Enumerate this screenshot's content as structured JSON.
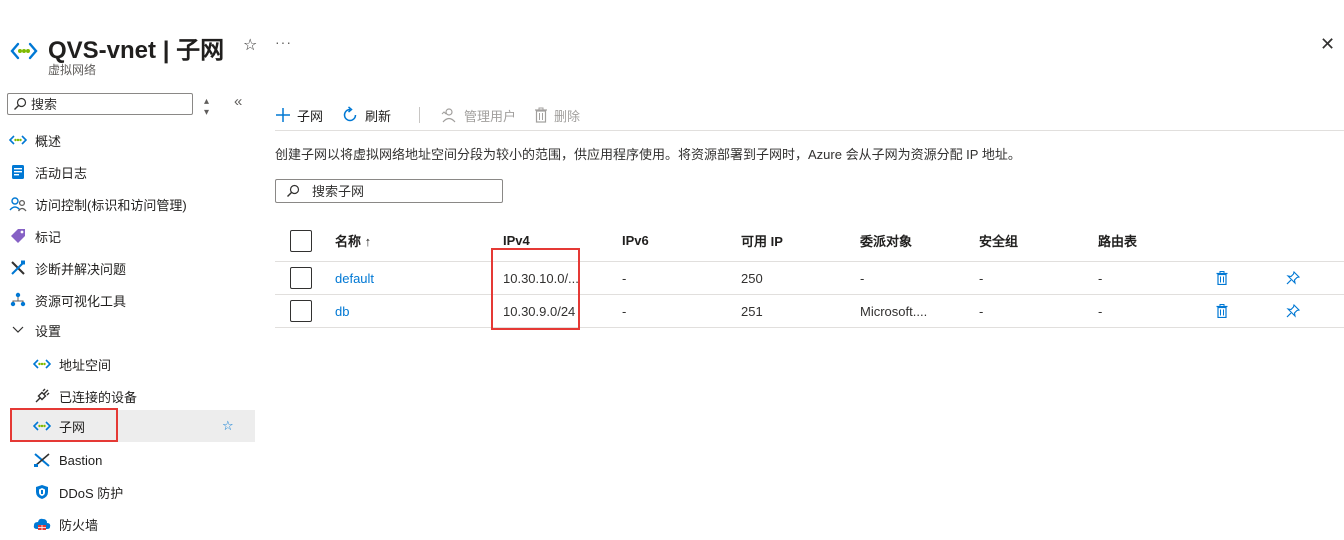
{
  "header": {
    "title": "QVS-vnet | 子网",
    "subtitle": "虚拟网络",
    "star": "☆",
    "more": "···",
    "close": "✕"
  },
  "sidebar": {
    "search_placeholder": "搜索",
    "sort_glyph": "⌃",
    "collapse_glyph": "«",
    "items": [
      {
        "label": "概述",
        "icon": "vnet-icon"
      },
      {
        "label": "活动日志",
        "icon": "activity-log-icon"
      },
      {
        "label": "访问控制(标识和访问管理)",
        "icon": "iam-icon"
      },
      {
        "label": "标记",
        "icon": "tag-icon"
      },
      {
        "label": "诊断并解决问题",
        "icon": "diagnose-icon"
      },
      {
        "label": "资源可视化工具",
        "icon": "visualizer-icon"
      },
      {
        "label": "设置",
        "icon": "chevron-down-icon"
      },
      {
        "label": "地址空间",
        "icon": "vnet-icon"
      },
      {
        "label": "已连接的设备",
        "icon": "plug-icon"
      },
      {
        "label": "子网",
        "icon": "vnet-icon"
      },
      {
        "label": "Bastion",
        "icon": "bastion-icon"
      },
      {
        "label": "DDoS 防护",
        "icon": "shield-icon"
      },
      {
        "label": "防火墙",
        "icon": "firewall-icon"
      }
    ],
    "favorite_star": "☆"
  },
  "toolbar": {
    "add_label": "子网",
    "refresh_label": "刷新",
    "manage_users_label": "管理用户",
    "delete_label": "删除"
  },
  "description": "创建子网以将虚拟网络地址空间分段为较小的范围，供应用程序使用。将资源部署到子网时，Azure 会从子网为资源分配 IP 地址。",
  "filter_placeholder": "搜索子网",
  "table": {
    "columns": [
      "名称 ↑",
      "IPv4",
      "IPv6",
      "可用 IP",
      "委派对象",
      "安全组",
      "路由表"
    ],
    "rows": [
      {
        "name": "default",
        "ipv4": "10.30.10.0/...",
        "ipv6": "-",
        "available_ip": "250",
        "delegation": "-",
        "nsg": "-",
        "route_table": "-"
      },
      {
        "name": "db",
        "ipv4": "10.30.9.0/24",
        "ipv6": "-",
        "available_ip": "251",
        "delegation": "Microsoft....",
        "nsg": "-",
        "route_table": "-"
      }
    ]
  },
  "colors": {
    "accent": "#0078d4",
    "highlight": "#e53935",
    "vnet_green": "#7fba00"
  }
}
